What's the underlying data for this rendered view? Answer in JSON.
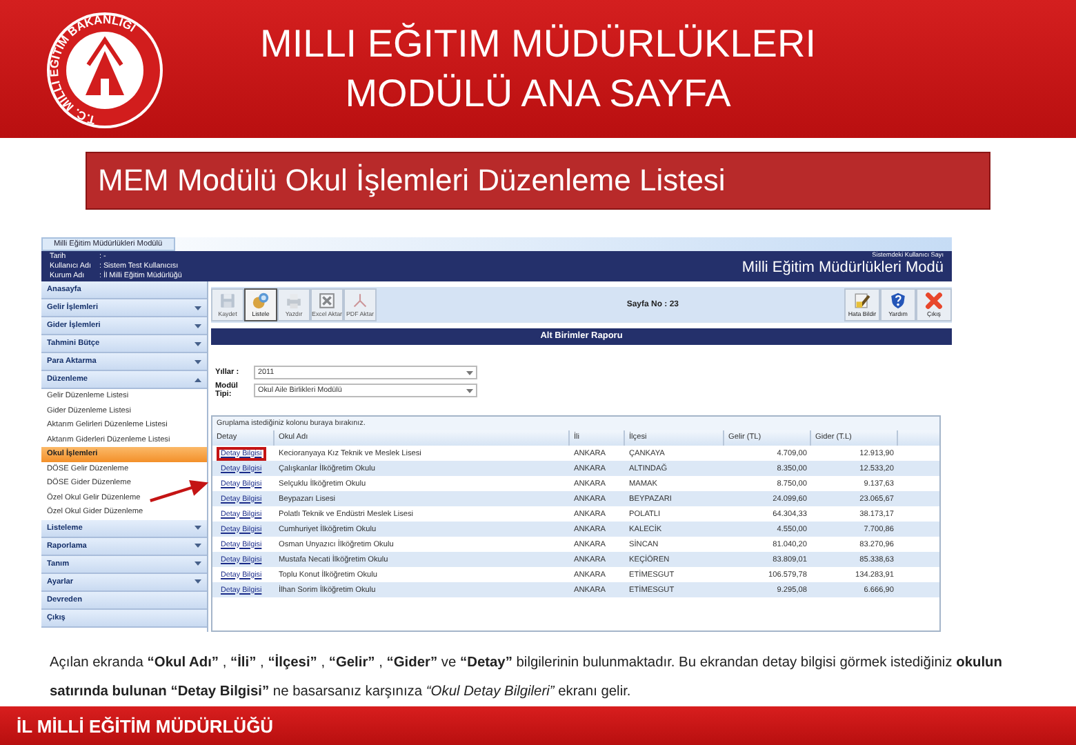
{
  "header": {
    "logo_text": "T.C. MİLLİ EĞİTİM BAKANLIĞI",
    "title_lines": [
      "MILLI EĞITIM MÜDÜRLÜKLERI",
      "MODÜLÜ ANA SAYFA"
    ]
  },
  "subtitle": "MEM Modülü Okul İşlemleri Düzenleme Listesi",
  "app": {
    "tab": "Milli Eğitim Müdürlükleri Modülü",
    "info": [
      {
        "label": "Tarih",
        "value": ": -"
      },
      {
        "label": "Kullanıcı Adı",
        "value": ": Sistem Test Kullanıcısı"
      },
      {
        "label": "Kurum Adı",
        "value": ": İl Milli Eğitim Müdürlüğü"
      }
    ],
    "user_count": "Sistemdeki Kullanıcı Sayı",
    "app_title": "Milli Eğitim Müdürlükleri Modü",
    "menu": [
      {
        "label": "Anasayfa",
        "kind": "plain"
      },
      {
        "label": "Gelir İşlemleri",
        "kind": "group",
        "expanded": false
      },
      {
        "label": "Gider İşlemleri",
        "kind": "group",
        "expanded": false
      },
      {
        "label": "Tahmini Bütçe",
        "kind": "group",
        "expanded": false
      },
      {
        "label": "Para Aktarma",
        "kind": "group",
        "expanded": false
      },
      {
        "label": "Düzenleme",
        "kind": "group",
        "expanded": true,
        "children": [
          {
            "label": "Gelir Düzenleme Listesi",
            "selected": false
          },
          {
            "label": "Gider Düzenleme Listesi",
            "selected": false
          },
          {
            "label": "Aktarım Gelirleri Düzenleme Listesi",
            "selected": false
          },
          {
            "label": "Aktarım Giderleri Düzenleme Listesi",
            "selected": false
          },
          {
            "label": "Okul İşlemleri",
            "selected": true
          },
          {
            "label": "DÖSE Gelir Düzenleme",
            "selected": false
          },
          {
            "label": "DÖSE Gider Düzenleme",
            "selected": false
          },
          {
            "label": "Özel Okul Gelir Düzenleme",
            "selected": false
          },
          {
            "label": "Özel Okul Gider Düzenleme",
            "selected": false
          }
        ]
      },
      {
        "label": "Listeleme",
        "kind": "group",
        "expanded": false
      },
      {
        "label": "Raporlama",
        "kind": "group",
        "expanded": false
      },
      {
        "label": "Tanım",
        "kind": "group",
        "expanded": false
      },
      {
        "label": "Ayarlar",
        "kind": "group",
        "expanded": false
      },
      {
        "label": "Devreden",
        "kind": "plain"
      },
      {
        "label": "Çıkış",
        "kind": "plain"
      }
    ],
    "toolbar": [
      {
        "label": "Kaydet",
        "kind": "save",
        "disabled": true,
        "selected": false
      },
      {
        "label": "Listele",
        "kind": "list",
        "disabled": false,
        "selected": true
      },
      {
        "label": "Yazdır",
        "kind": "print",
        "disabled": true,
        "selected": false
      },
      {
        "label": "Excel Aktar",
        "kind": "excel",
        "disabled": true,
        "selected": false
      },
      {
        "label": "PDF Aktar",
        "kind": "pdf",
        "disabled": true,
        "selected": false
      }
    ],
    "page_no": "Sayfa No : 23",
    "right_toolbar": [
      {
        "label": "Hata Bildir",
        "kind": "report"
      },
      {
        "label": "Yardım",
        "kind": "help"
      },
      {
        "label": "Çıkış",
        "kind": "exit"
      }
    ],
    "report_title": "Alt Birimler Raporu",
    "filters": [
      {
        "label": "Yıllar :",
        "value": "2011"
      },
      {
        "label": "Modül Tipi:",
        "value": "Okul Aile Birlikleri Modülü"
      }
    ],
    "group_hint": "Gruplama istediğiniz kolonu buraya bırakınız.",
    "table": {
      "columns": [
        "Detay",
        "Okul Adı",
        "İli",
        "İlçesi",
        "Gelir (TL)",
        "Gider (T.L)"
      ],
      "rows": [
        {
          "highlighted": true,
          "cells": [
            "Detay Bilgisi",
            "Kecioranyaya Kız Teknik ve Meslek Lisesi",
            "ANKARA",
            "ÇANKAYA",
            "4.709,00",
            "12.913,90"
          ]
        },
        {
          "highlighted": false,
          "cells": [
            "Detay Bilgisi",
            "Çalışkanlar İlköğretim Okulu",
            "ANKARA",
            "ALTINDAĞ",
            "8.350,00",
            "12.533,20"
          ]
        },
        {
          "highlighted": false,
          "cells": [
            "Detay Bilgisi",
            "Selçuklu İlköğretim Okulu",
            "ANKARA",
            "MAMAK",
            "8.750,00",
            "9.137,63"
          ]
        },
        {
          "highlighted": false,
          "cells": [
            "Detay Bilgisi",
            "Beypazarı Lisesi",
            "ANKARA",
            "BEYPAZARI",
            "24.099,60",
            "23.065,67"
          ]
        },
        {
          "highlighted": false,
          "cells": [
            "Detay Bilgisi",
            "Polatlı Teknik ve Endüstri Meslek Lisesi",
            "ANKARA",
            "POLATLI",
            "64.304,33",
            "38.173,17"
          ]
        },
        {
          "highlighted": false,
          "cells": [
            "Detay Bilgisi",
            "Cumhuriyet İlköğretim Okulu",
            "ANKARA",
            "KALECİK",
            "4.550,00",
            "7.700,86"
          ]
        },
        {
          "highlighted": false,
          "cells": [
            "Detay Bilgisi",
            "Osman Unyazıcı İlköğretim Okulu",
            "ANKARA",
            "SİNCAN",
            "81.040,20",
            "83.270,96"
          ]
        },
        {
          "highlighted": false,
          "cells": [
            "Detay Bilgisi",
            "Mustafa Necati İlköğretim Okulu",
            "ANKARA",
            "KEÇİÖREN",
            "83.809,01",
            "85.338,63"
          ]
        },
        {
          "highlighted": false,
          "cells": [
            "Detay Bilgisi",
            "Toplu Konut İlköğretim Okulu",
            "ANKARA",
            "ETİMESGUT",
            "106.579,78",
            "134.283,91"
          ]
        },
        {
          "highlighted": false,
          "cells": [
            "Detay Bilgisi",
            "İlhan Sorim İlköğretim Okulu",
            "ANKARA",
            "ETİMESGUT",
            "9.295,08",
            "6.666,90"
          ]
        }
      ]
    }
  },
  "caption": "Açılan ekranda **“Okul Adı”** , **“İli”** , **“İlçesi”** , **“Gelir”** , **“Gider”** ve **“Detay”** bilgilerinin bulunmaktadır. Bu ekrandan detay bilgisi görmek istediğiniz **okulun satırında bulunan “Detay Bilgisi”** ne basarsanız karşınıza *“Okul Detay Bilgileri”* ekranı gelir.",
  "footer": "İL MİLLİ EĞİTİM MÜDÜRLÜĞÜ"
}
